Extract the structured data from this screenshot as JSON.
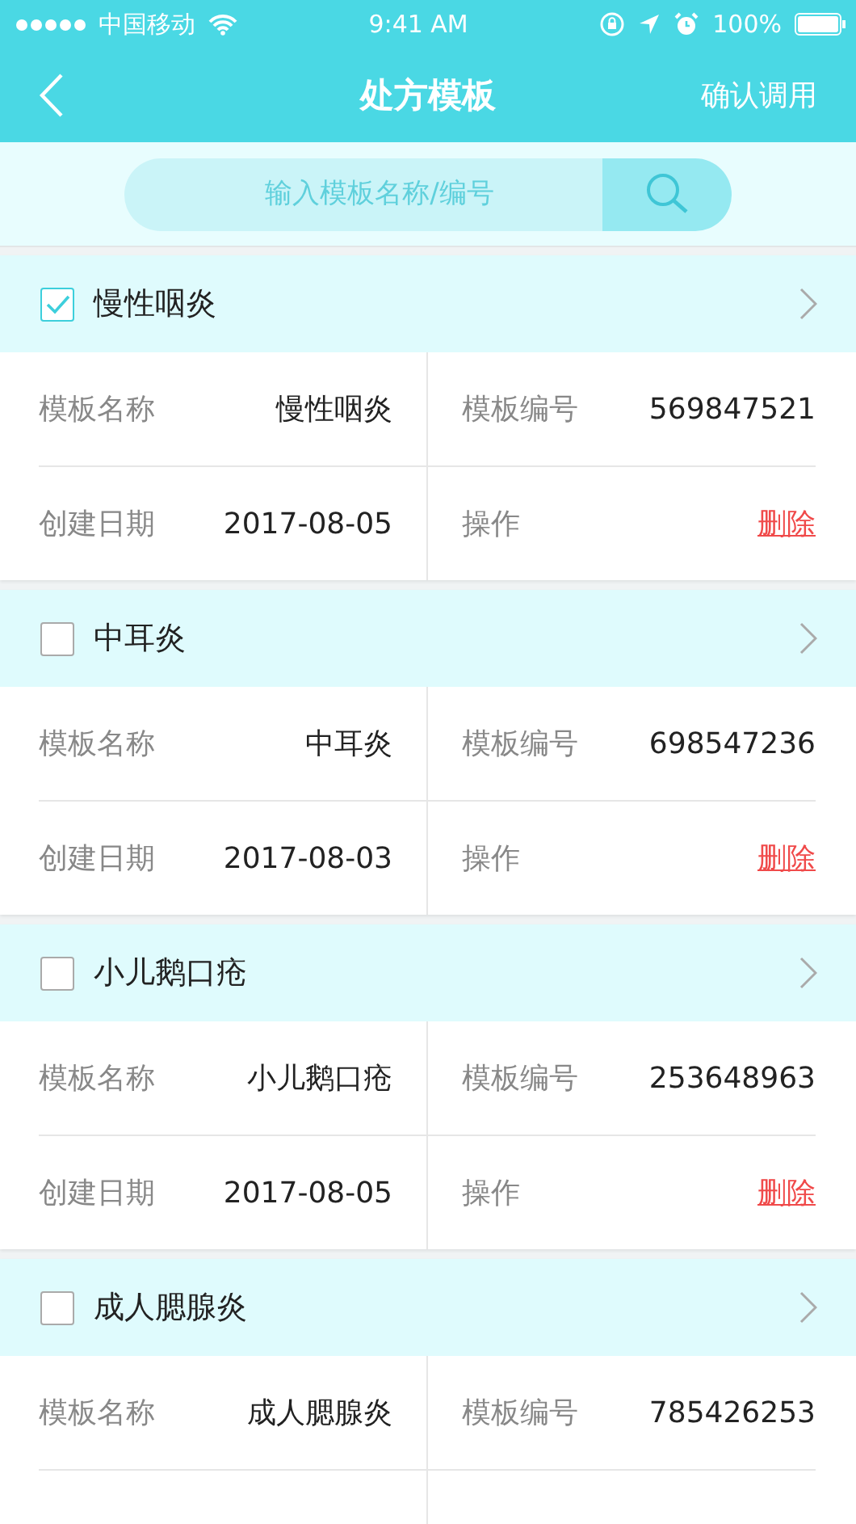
{
  "status_bar": {
    "carrier": "中国移动",
    "time": "9:41 AM",
    "battery": "100%"
  },
  "nav": {
    "title": "处方模板",
    "action": "确认调用"
  },
  "search": {
    "placeholder": "输入模板名称/编号"
  },
  "templates": [
    {
      "title": "慢性咽炎",
      "checked": true,
      "name_label": "模板名称",
      "name": "慢性咽炎",
      "code_label": "模板编号",
      "code": "569847521",
      "date_label": "创建日期",
      "date": "2017-08-05",
      "op_label": "操作",
      "op": "删除"
    },
    {
      "title": "中耳炎",
      "checked": false,
      "name_label": "模板名称",
      "name": "中耳炎",
      "code_label": "模板编号",
      "code": "698547236",
      "date_label": "创建日期",
      "date": "2017-08-03",
      "op_label": "操作",
      "op": "删除"
    },
    {
      "title": "小儿鹅口疮",
      "checked": false,
      "name_label": "模板名称",
      "name": "小儿鹅口疮",
      "code_label": "模板编号",
      "code": "253648963",
      "date_label": "创建日期",
      "date": "2017-08-05",
      "op_label": "操作",
      "op": "删除"
    },
    {
      "title": "成人腮腺炎",
      "checked": false,
      "name_label": "模板名称",
      "name": "成人腮腺炎",
      "code_label": "模板编号",
      "code": "785426253"
    }
  ]
}
